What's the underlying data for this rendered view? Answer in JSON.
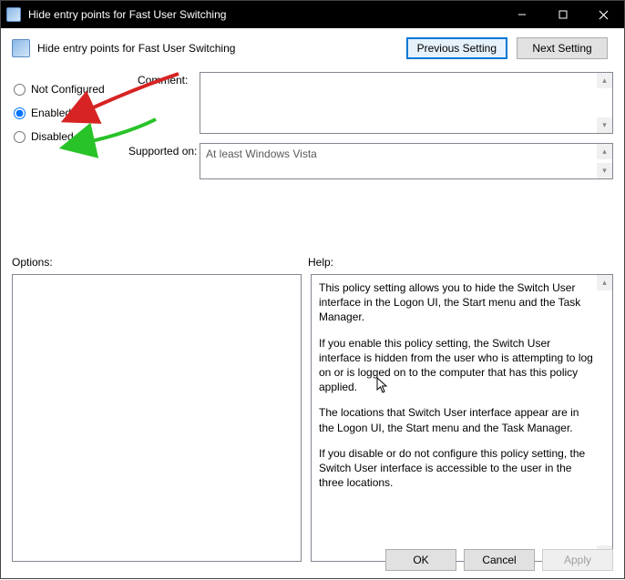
{
  "titlebar": {
    "title": "Hide entry points for Fast User Switching"
  },
  "header": {
    "caption": "Hide entry points for Fast User Switching",
    "prev_btn": "Previous Setting",
    "next_btn": "Next Setting"
  },
  "radios": {
    "not_configured": "Not Configured",
    "enabled": "Enabled",
    "disabled": "Disabled",
    "selected": "enabled"
  },
  "comment": {
    "label": "Comment:",
    "value": ""
  },
  "supported": {
    "label": "Supported on:",
    "value": "At least Windows Vista"
  },
  "labels": {
    "options": "Options:",
    "help": "Help:"
  },
  "help": {
    "p1": "This policy setting allows you to hide the Switch User interface in the Logon UI, the Start menu and the Task Manager.",
    "p2": "If you enable this policy setting, the Switch User interface is hidden from the user who is attempting to log on or is logged on to the computer that has this policy applied.",
    "p3": "The locations that Switch User interface appear are in the Logon UI, the Start menu and the Task Manager.",
    "p4": "If you disable or do not configure this policy setting, the Switch User interface is accessible to the user in the three locations."
  },
  "bottom": {
    "ok": "OK",
    "cancel": "Cancel",
    "apply": "Apply"
  }
}
